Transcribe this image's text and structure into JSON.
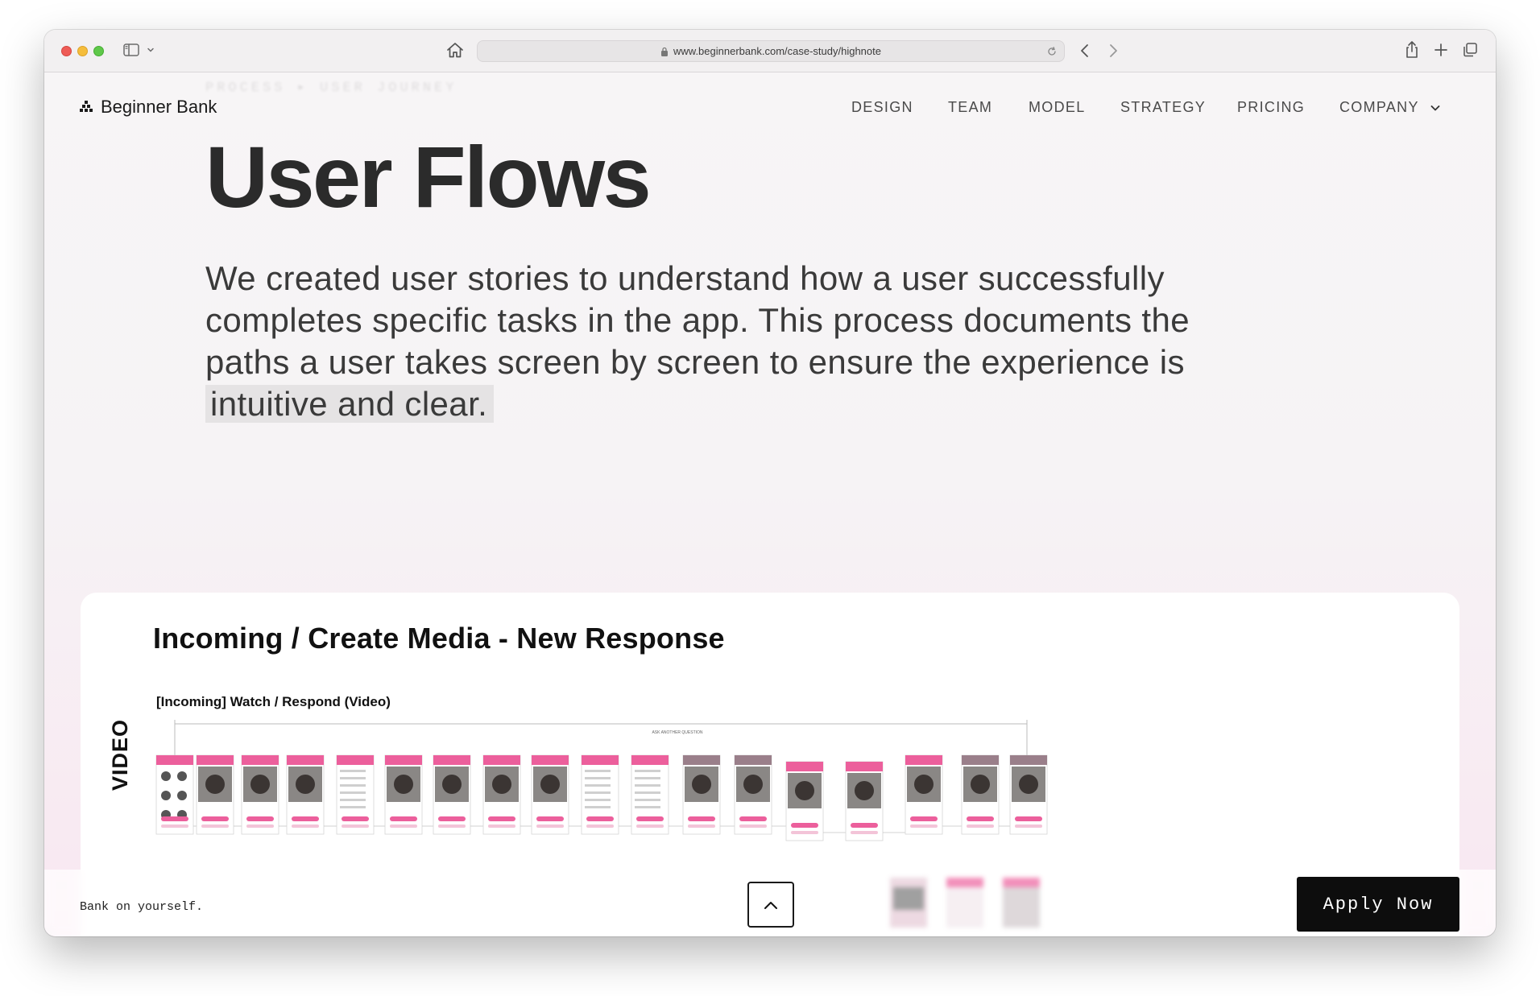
{
  "browser": {
    "url": "www.beginnerbank.com/case-study/highnote"
  },
  "header": {
    "ghost_breadcrumb": "PROCESS  ▸  USER JOURNEY",
    "logo_text": "Beginner Bank",
    "nav": [
      "DESIGN",
      "TEAM",
      "MODEL",
      "STRATEGY",
      "PRICING",
      "COMPANY"
    ]
  },
  "hero": {
    "title": "User Flows",
    "text_lines": [
      "We created user stories to understand how a user successfully",
      "completes specific tasks in the app. This process documents the",
      "paths a user takes screen by screen to ensure the experience is"
    ],
    "highlight": "intuitive and clear."
  },
  "card": {
    "title": "Incoming / Create Media - New Response",
    "flow_label": "[Incoming] Watch  / Respond (Video)",
    "side_label": "VIDEO",
    "diagram_caption": "ASK ANOTHER QUESTION"
  },
  "footer": {
    "tagline": "Bank on yourself.",
    "apply_label": "Apply Now"
  },
  "colors": {
    "accent_pink": "#ec5f9c",
    "page_bg": "#f7f5f6",
    "button_dark": "#0d0d0d"
  },
  "icons": [
    "sidebar-icon",
    "chevron-down-icon",
    "home-icon",
    "lock-icon",
    "reload-icon",
    "back-arrow-icon",
    "forward-arrow-icon",
    "share-icon",
    "plus-icon",
    "tabs-icon",
    "logo-icon",
    "chevron-up-icon"
  ]
}
